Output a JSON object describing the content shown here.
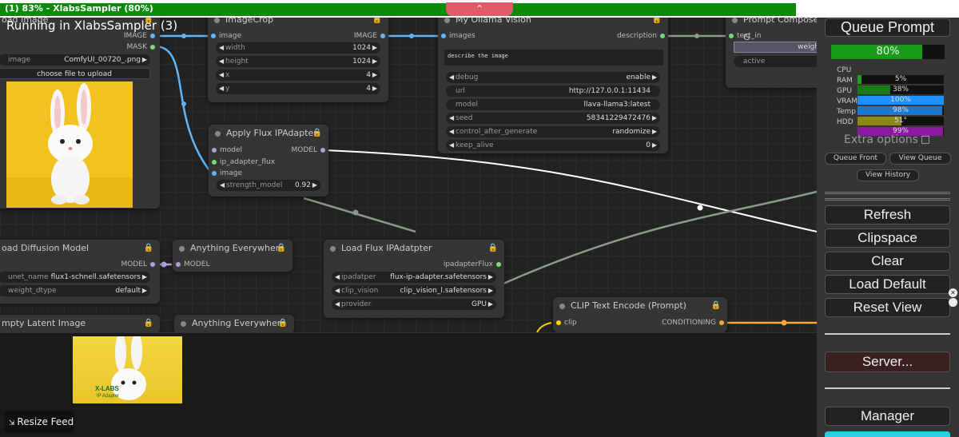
{
  "titlebar": {
    "text": "(1) 83% - XlabsSampler (80%)",
    "progress": 0.83,
    "tab_icon": "comfy-logo-icon"
  },
  "running": "Running in XlabsSampler (3)",
  "nodes": {
    "load_image": {
      "title": "oad Image",
      "out_image": "IMAGE",
      "out_mask": "MASK",
      "image_label": "image",
      "image_value": "ComfyUI_00720_.png",
      "upload": "choose file to upload"
    },
    "image_crop": {
      "title": "ImageCrop",
      "in_image": "image",
      "out_image": "IMAGE",
      "widgets": [
        {
          "label": "width",
          "value": "1024"
        },
        {
          "label": "height",
          "value": "1024"
        },
        {
          "label": "x",
          "value": "4"
        },
        {
          "label": "y",
          "value": "4"
        }
      ]
    },
    "ollama": {
      "title": "My Ollama Vision",
      "in_images": "images",
      "out_description": "description",
      "prompt": "describe the image",
      "widgets": [
        {
          "label": "debug",
          "value": "enable"
        },
        {
          "label": "url",
          "value": "http://127.0.0.1:11434"
        },
        {
          "label": "model",
          "value": "llava-llama3:latest"
        },
        {
          "label": "seed",
          "value": "58341229472476"
        },
        {
          "label": "control_after_generate",
          "value": "randomize"
        },
        {
          "label": "keep_alive",
          "value": "0"
        }
      ]
    },
    "prompt_composer": {
      "title": "Prompt Composer G",
      "in_text": "text_in",
      "weight": "weigh",
      "active": "active"
    },
    "apply_flux": {
      "title": "Apply Flux IPAdapter",
      "in_model": "model",
      "in_ipadapter": "ip_adapter_flux",
      "in_image": "image",
      "out_model": "MODEL",
      "strength_label": "strength_model",
      "strength_value": "0.92"
    },
    "load_diffusion": {
      "title": "oad Diffusion Model",
      "out_model": "MODEL",
      "unet_label": "unet_name",
      "unet_value": "flux1-schnell.safetensors",
      "dtype_label": "weight_dtype",
      "dtype_value": "default"
    },
    "anything1": {
      "title": "Anything Everywhere",
      "in_model": "MODEL"
    },
    "load_flux_ip": {
      "title": "Load Flux IPAdatpter",
      "out": "ipadapterFlux",
      "widgets": [
        {
          "label": "ipadatper",
          "value": "flux-ip-adapter.safetensors"
        },
        {
          "label": "clip_vision",
          "value": "clip_vision_l.safetensors"
        },
        {
          "label": "provider",
          "value": "GPU"
        }
      ]
    },
    "clip_text": {
      "title": "CLIP Text Encode (Prompt)",
      "in_clip": "clip",
      "out": "CONDITIONING"
    },
    "empty_latent": {
      "title": "mpty Latent Image"
    },
    "anything2": {
      "title": "Anything Everywhere"
    }
  },
  "feed": {
    "resize": "Resize Feed",
    "img_text1": "X-LABS",
    "img_text2": "IP Adapter"
  },
  "menu": {
    "queue_prompt": "Queue Prompt",
    "progress_label": "80%",
    "progress": 0.8,
    "stats": [
      {
        "label": "CPU",
        "value": "5%",
        "fill": 0.05,
        "color": "#1aa31a"
      },
      {
        "label": "RAM",
        "value": "38%",
        "fill": 0.38,
        "color": "#1a7a1a"
      },
      {
        "label": "GPU",
        "value": "100%",
        "fill": 1.0,
        "color": "#1e90ff"
      },
      {
        "label": "VRAM",
        "value": "98%",
        "fill": 0.98,
        "color": "#1e78d0"
      },
      {
        "label": "Temp",
        "value": "51°",
        "fill": 0.51,
        "color": "#8a8a10"
      },
      {
        "label": "HDD",
        "value": "99%",
        "fill": 0.99,
        "color": "#8a1aa0"
      }
    ],
    "extra_options": "Extra options",
    "queue_front": "Queue Front",
    "view_queue": "View Queue",
    "view_history": "View History",
    "refresh": "Refresh",
    "clipspace": "Clipspace",
    "clear": "Clear",
    "load_default": "Load Default",
    "reset_view": "Reset View",
    "server": "Server...",
    "manager": "Manager"
  },
  "colors": {
    "image": "#64b5f6",
    "model": "#b39ddb",
    "green": "#7cdc7c",
    "clip": "#ffd500",
    "cond": "#ffa931"
  }
}
